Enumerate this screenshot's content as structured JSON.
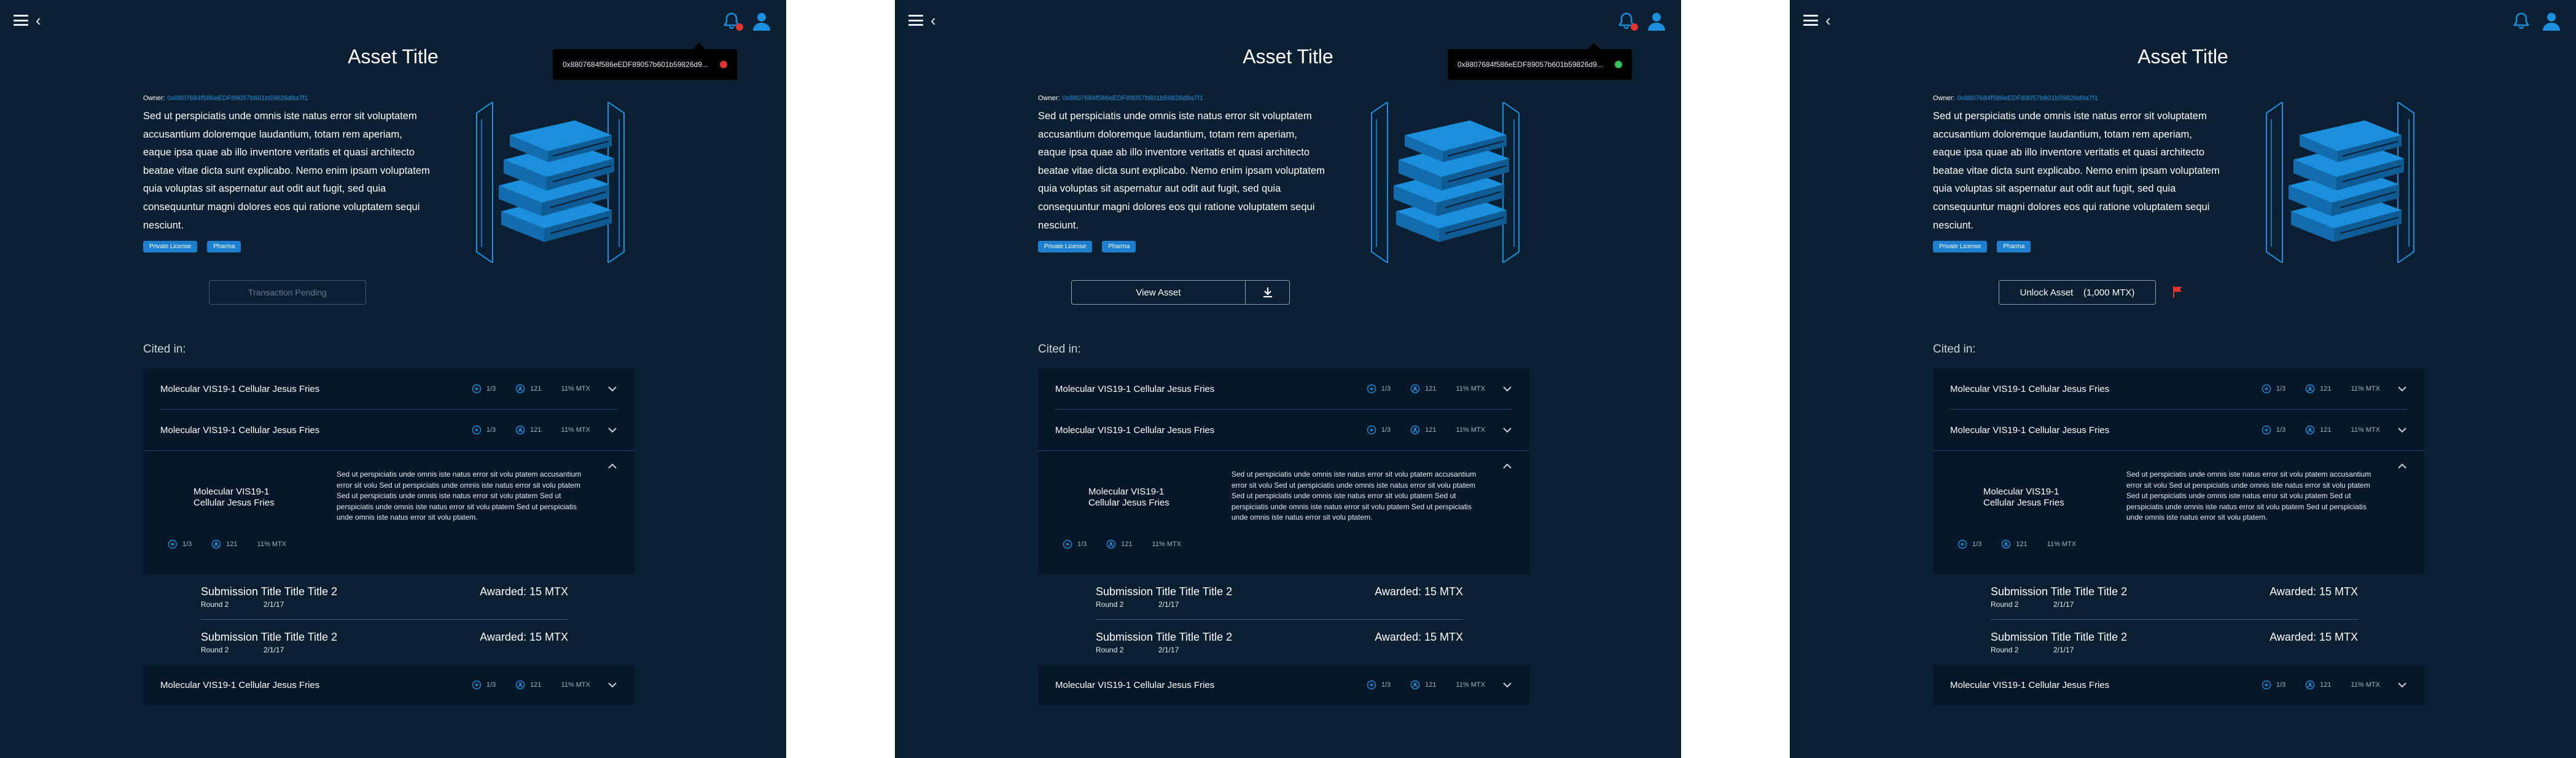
{
  "colors": {
    "background": "#0b1f33",
    "row_background": "#07172a",
    "accent": "#1c8fdc",
    "notification_red": "#e3342f",
    "status_green": "#37c55a"
  },
  "screens": [
    {
      "title": "Asset Title",
      "tooltip": {
        "address": "0x8807684f586eEDF89057b601b59826d9...",
        "status": "red"
      },
      "owner_label": "Owner:",
      "owner_value": "0x8807684f586eEDF89057b601b59826d9a7f1",
      "description": "Sed ut perspiciatis unde omnis iste natus error sit voluptatem accusantium doloremque laudantium, totam rem aperiam, eaque ipsa quae ab illo inventore veritatis et quasi architecto beatae vitae dicta sunt explicabo. Nemo enim ipsam voluptatem quia voluptas sit aspernatur aut odit aut fugit, sed quia consequuntur magni dolores eos qui ratione voluptatem sequi nesciunt.",
      "tags": [
        "Private License",
        "Pharma"
      ],
      "action": {
        "label": "Transaction Pending"
      },
      "cited_label": "Cited in:"
    },
    {
      "title": "Asset Title",
      "tooltip": {
        "address": "0x8807684f586eEDF89057b601b59826d9...",
        "status": "green"
      },
      "owner_label": "Owner:",
      "owner_value": "0x8807684f586eEDF89057b601b59826d9a7f1",
      "description": "Sed ut perspiciatis unde omnis iste natus error sit voluptatem accusantium doloremque laudantium, totam rem aperiam, eaque ipsa quae ab illo inventore veritatis et quasi architecto beatae vitae dicta sunt explicabo. Nemo enim ipsam voluptatem quia voluptas sit aspernatur aut odit aut fugit, sed quia consequuntur magni dolores eos qui ratione voluptatem sequi nesciunt.",
      "tags": [
        "Private License",
        "Pharma"
      ],
      "action": {
        "label": "View Asset"
      },
      "cited_label": "Cited in:"
    },
    {
      "title": "Asset Title",
      "owner_label": "Owner:",
      "owner_value": "0x8807684f586eEDF89057b601b59826d9a7f1",
      "description": "Sed ut perspiciatis unde omnis iste natus error sit voluptatem accusantium doloremque laudantium, totam rem aperiam, eaque ipsa quae ab illo inventore veritatis et quasi architecto beatae vitae dicta sunt explicabo. Nemo enim ipsam voluptatem quia voluptas sit aspernatur aut odit aut fugit, sed quia consequuntur magni dolores eos qui ratione voluptatem sequi nesciunt.",
      "tags": [
        "Private License",
        "Pharma"
      ],
      "action": {
        "label": "Unlock Asset    (1,000 MTX)"
      },
      "cited_label": "Cited in:"
    }
  ],
  "citations": {
    "row_title": "Molecular VIS19-1 Cellular Jesus Fries",
    "meta": {
      "versions": "1/3",
      "contributors": "121",
      "price": "11% MTX"
    },
    "expanded": {
      "title": "Molecular VIS19-1 Cellular Jesus Fries",
      "text": "Sed ut perspiciatis unde omnis iste natus error sit volu ptatem accusantium error sit volu Sed ut perspiciatis unde omnis iste natus error sit volu ptatem Sed ut perspiciatis unde omnis iste natus error sit volu ptatem Sed ut perspiciatis unde omnis iste natus error sit volu ptatem Sed ut perspiciatis unde omnis iste natus error sit volu ptatem.",
      "meta": {
        "versions": "1/3",
        "contributors": "121",
        "price": "11% MTX"
      }
    },
    "submissions": [
      {
        "title": "Submission Title Title Title 2",
        "round": "Round 2",
        "date": "2/1/17",
        "awarded": "Awarded: 15 MTX"
      },
      {
        "title": "Submission Title Title Title 2",
        "round": "Round 2",
        "date": "2/1/17",
        "awarded": "Awarded: 15 MTX"
      }
    ]
  }
}
